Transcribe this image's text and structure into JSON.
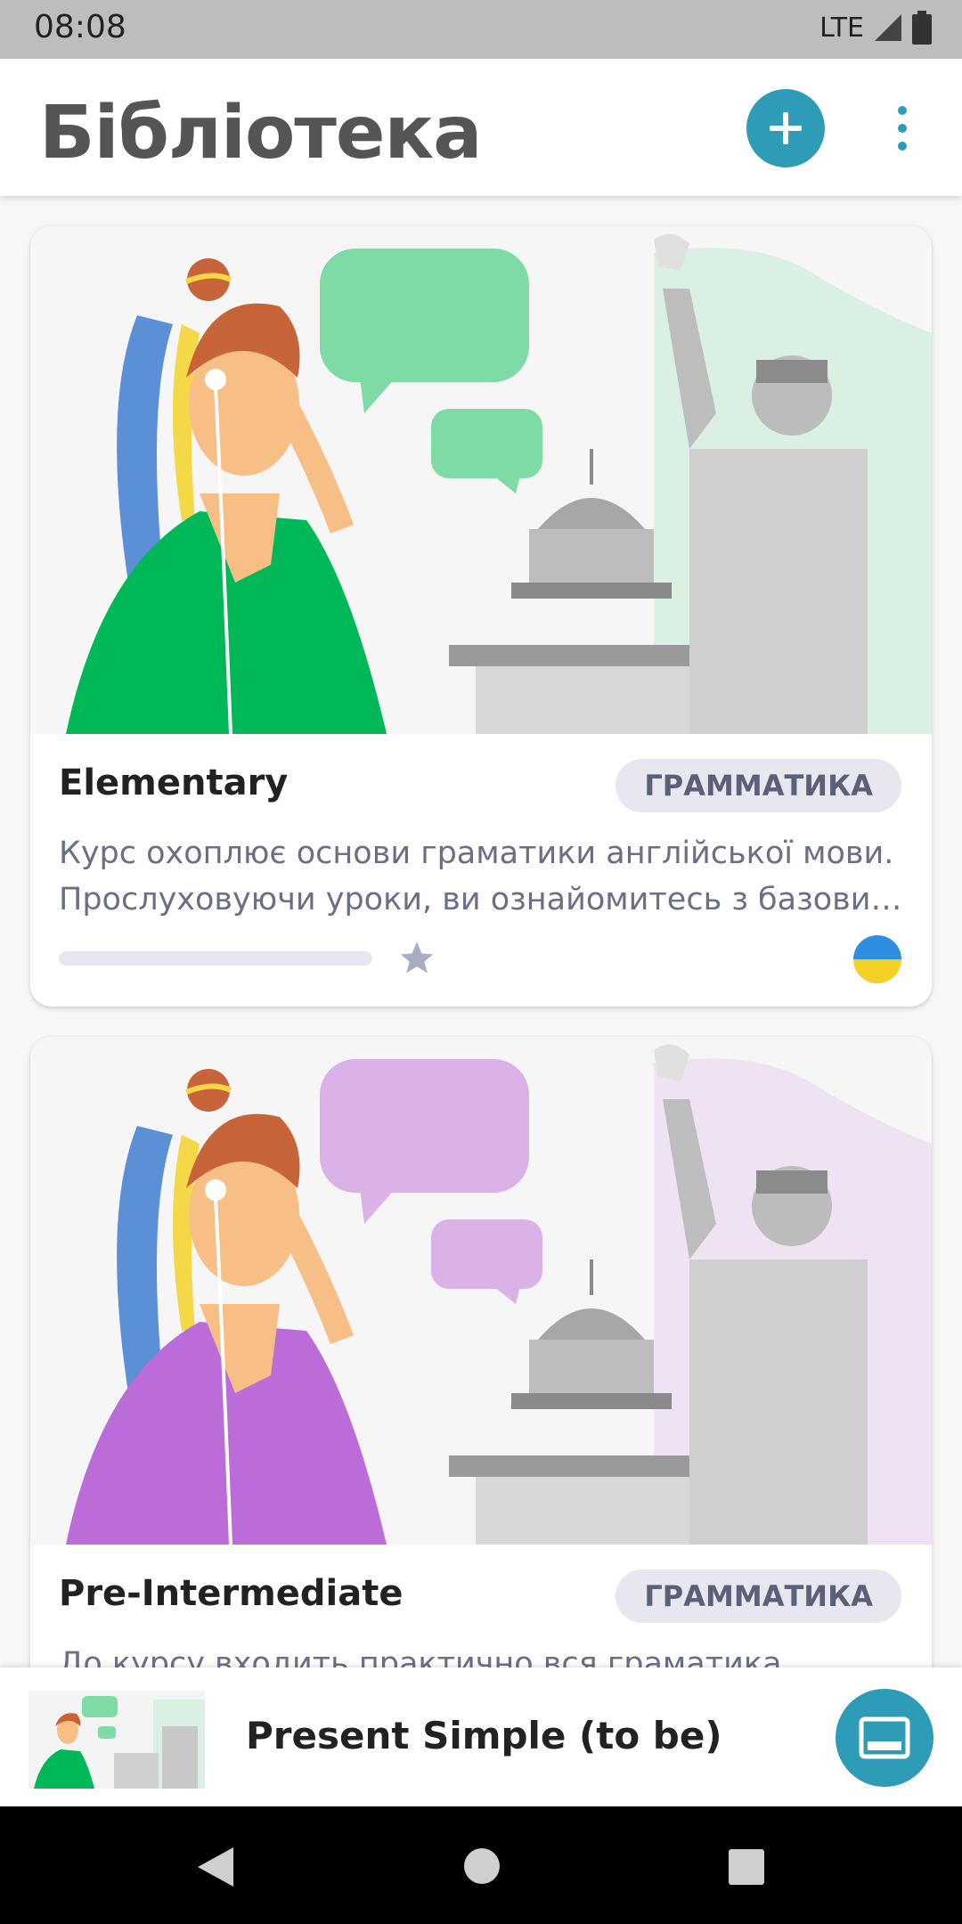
{
  "status_bar": {
    "time": "08:08",
    "network": "LTE"
  },
  "app_bar": {
    "title": "Бібліотека",
    "add_icon": "plus-icon",
    "menu_icon": "more-vert-icon"
  },
  "courses": [
    {
      "title": "Elementary",
      "category": "ГРАММАТИКА",
      "description_lines": [
        "Курс охоплює основи граматики англійської мови.",
        "Прослуховуючи уроки, ви ознайомитесь з базовими…"
      ],
      "accent_color": "#00b857",
      "bubble_color": "#7fdba6",
      "bg_tint": "#d9f0e3",
      "progress": 0.0
    },
    {
      "title": "Pre-Intermediate",
      "category": "ГРАММАТИКА",
      "description_lines": [
        "До курсу входить практично вся граматика"
      ],
      "accent_color": "#bb6cd9",
      "bubble_color": "#dbb2e8",
      "bg_tint": "#efe2f3"
    }
  ],
  "mini_player": {
    "title": "Present Simple (to be)",
    "icon": "cast-screen-icon"
  },
  "colors": {
    "accent": "#2e9bb7",
    "chip_bg": "#e6e7ef",
    "chip_text": "#5b6078"
  }
}
